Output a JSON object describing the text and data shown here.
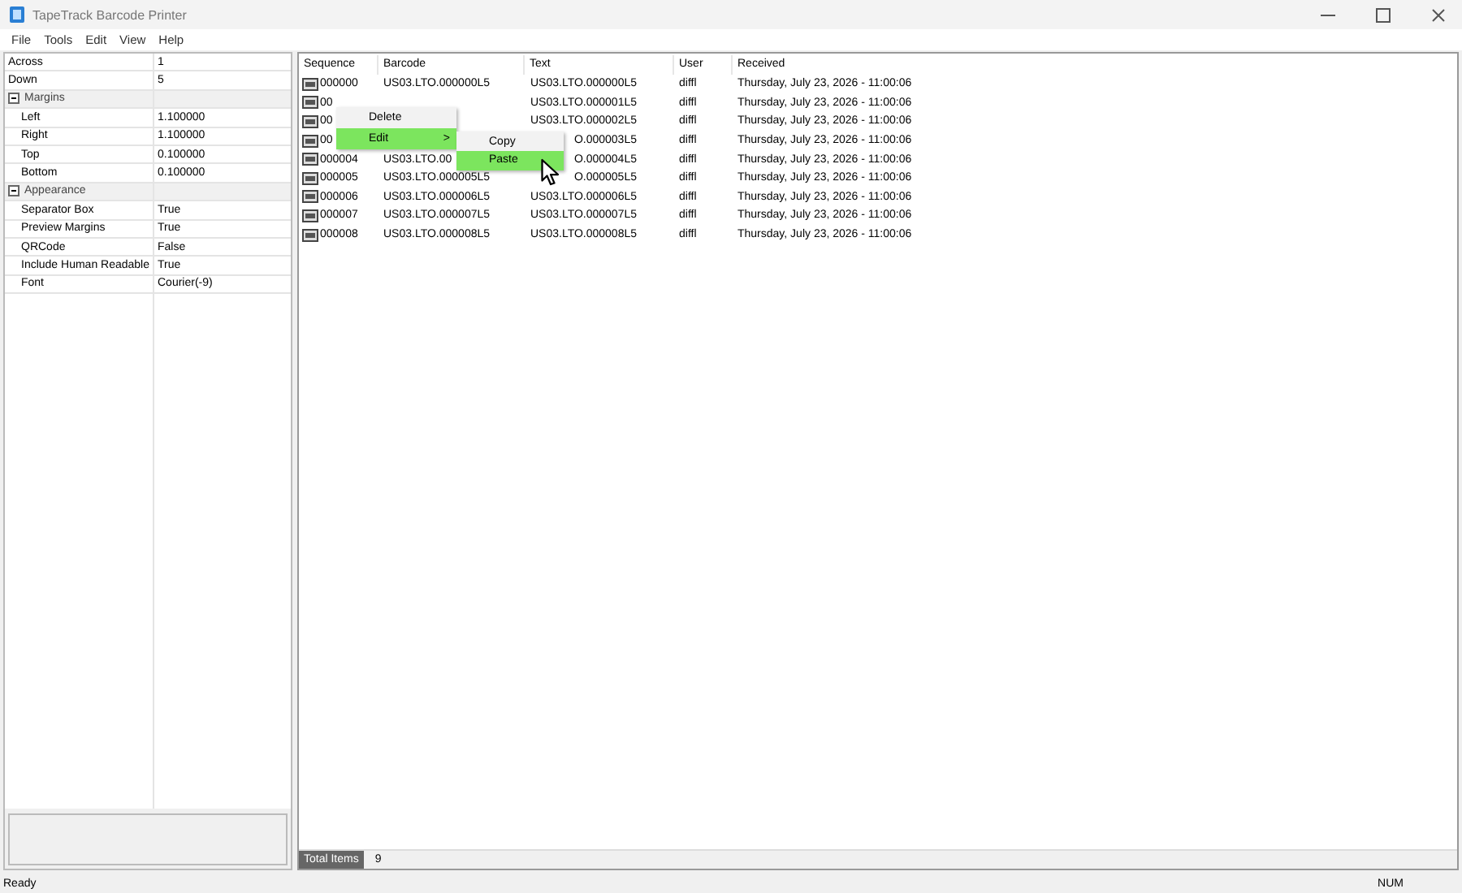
{
  "window": {
    "title": "TapeTrack Barcode Printer"
  },
  "menu": [
    "File",
    "Tools",
    "Edit",
    "View",
    "Help"
  ],
  "properties": [
    {
      "kind": "property",
      "name": "Across",
      "value": "1"
    },
    {
      "kind": "property",
      "name": "Down",
      "value": "5"
    },
    {
      "kind": "category",
      "name": "Margins",
      "expanded": true,
      "children": [
        {
          "kind": "property",
          "name": "Left",
          "value": "1.100000"
        },
        {
          "kind": "property",
          "name": "Right",
          "value": "1.100000"
        },
        {
          "kind": "property",
          "name": "Top",
          "value": "0.100000"
        },
        {
          "kind": "property",
          "name": "Bottom",
          "value": "0.100000"
        }
      ]
    },
    {
      "kind": "category",
      "name": "Appearance",
      "expanded": true,
      "children": [
        {
          "kind": "property",
          "name": "Separator Box",
          "value": "True"
        },
        {
          "kind": "property",
          "name": "Preview Margins",
          "value": "True"
        },
        {
          "kind": "property",
          "name": "QRCode",
          "value": "False"
        },
        {
          "kind": "property",
          "name": "Include Human Readable",
          "value": "True"
        },
        {
          "kind": "property",
          "name": "Font",
          "value": "Courier(-9)"
        }
      ]
    }
  ],
  "table": {
    "columns": [
      "Sequence",
      "Barcode",
      "Text",
      "User",
      "Received"
    ],
    "rows": [
      [
        "000000",
        "US03.LTO.000000L5",
        "US03.LTO.000000L5",
        "diffl",
        "Thursday, July 23, 2026 - 11:00:06"
      ],
      [
        "00",
        null,
        "US03.LTO.000001L5",
        "diffl",
        "Thursday, July 23, 2026 - 11:00:06"
      ],
      [
        "00",
        null,
        "US03.LTO.000002L5",
        "diffl",
        "Thursday, July 23, 2026 - 11:00:06"
      ],
      [
        "00",
        null,
        "O.000003L5",
        "diffl",
        "Thursday, July 23, 2026 - 11:00:06"
      ],
      [
        "000004",
        "US03.LTO.00",
        "O.000004L5",
        "diffl",
        "Thursday, July 23, 2026 - 11:00:06"
      ],
      [
        "000005",
        "US03.LTO.000005L5",
        "O.000005L5",
        "diffl",
        "Thursday, July 23, 2026 - 11:00:06"
      ],
      [
        "000006",
        "US03.LTO.000006L5",
        "US03.LTO.000006L5",
        "diffl",
        "Thursday, July 23, 2026 - 11:00:06"
      ],
      [
        "000007",
        "US03.LTO.000007L5",
        "US03.LTO.000007L5",
        "diffl",
        "Thursday, July 23, 2026 - 11:00:06"
      ],
      [
        "000008",
        "US03.LTO.000008L5",
        "US03.LTO.000008L5",
        "diffl",
        "Thursday, July 23, 2026 - 11:00:06"
      ]
    ]
  },
  "context_menu": {
    "items": [
      {
        "label": "Delete",
        "selected": false
      },
      {
        "label": "Edit",
        "selected": true,
        "arrow": ">"
      }
    ]
  },
  "submenu": {
    "items": [
      {
        "label": "Copy",
        "selected": false
      },
      {
        "label": "Paste",
        "selected": true
      }
    ]
  },
  "totals": {
    "label": "Total Items",
    "value": "9"
  },
  "status_bar": {
    "text": "Ready",
    "indicator": "NUM"
  }
}
